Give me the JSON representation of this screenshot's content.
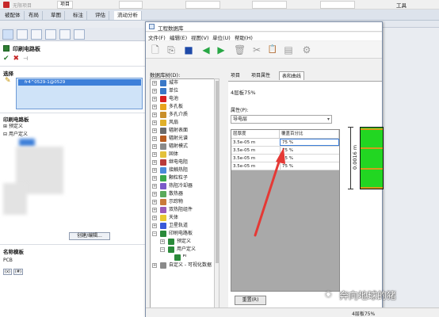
{
  "app": {
    "title": "无限项目",
    "project_label": "项目",
    "tools_label": "工具",
    "ribbon_tabs": [
      "被配体",
      "布局",
      "草图",
      "标注",
      "评估",
      "流动分析"
    ]
  },
  "left_panel": {
    "heading": "印刷电路板",
    "select_label": "选择",
    "selected_item": "fr4^0529-1@0529",
    "section_label": "印刷电路板",
    "tree": [
      "预定义",
      "用户定义"
    ],
    "create_button": "创建/编辑...",
    "name_section": "名称模板",
    "name_value": "PCB",
    "small_icons": [
      "(x)",
      "(#)"
    ]
  },
  "dialog": {
    "title": "工程数据库",
    "menu": [
      "文件(F)",
      "编辑(E)",
      "视图(V)",
      "单位(U)",
      "帮助(H)"
    ],
    "toolbar_icons": [
      "new-icon",
      "copy-icon",
      "save-icon",
      "back-icon",
      "forward-icon",
      "delete-icon",
      "cut-icon",
      "paste-icon",
      "document-icon",
      "settings-icon"
    ],
    "tree_label": "数据库树(D):",
    "tree": [
      {
        "label": "城市",
        "color": "#3a78c7"
      },
      {
        "label": "单位",
        "color": "#3a78c7"
      },
      {
        "label": "电池",
        "color": "#d92020"
      },
      {
        "label": "多孔板",
        "color": "#e8a31c"
      },
      {
        "label": "多孔介质",
        "color": "#c98f2a"
      },
      {
        "label": "风扇",
        "color": "#e0b02a"
      },
      {
        "label": "辐射表面",
        "color": "#6a6a6a"
      },
      {
        "label": "辐射光谱",
        "color": "#b85c20"
      },
      {
        "label": "辐射模式",
        "color": "#8a8a8a"
      },
      {
        "label": "固体",
        "color": "#e3c13a"
      },
      {
        "label": "继电电阻",
        "color": "#b83a3a"
      },
      {
        "label": "接触热阻",
        "color": "#4a8ad9"
      },
      {
        "label": "颗粒粒子",
        "color": "#3aa84a"
      },
      {
        "label": "热阻冷却器",
        "color": "#7a5ac9"
      },
      {
        "label": "散热器",
        "color": "#5aaa5a"
      },
      {
        "label": "示踪物",
        "color": "#c97a3a"
      },
      {
        "label": "双热阻组件",
        "color": "#9a5ab8"
      },
      {
        "label": "天体",
        "color": "#e8c830"
      },
      {
        "label": "卫星轨道",
        "color": "#3a5ad9"
      },
      {
        "label": "印刷电路板",
        "color": "#2a8a3a",
        "expanded": true
      },
      {
        "label": "预定义",
        "color": "#2a8a3a",
        "level": 1
      },
      {
        "label": "用户定义",
        "color": "#2a8a3a",
        "level": 1,
        "expanded": true
      },
      {
        "label": "",
        "color": "#2a8a3a",
        "level": 2
      },
      {
        "label": "自定义 - 可视化数据",
        "color": "#8a8a8a"
      }
    ],
    "tabs": [
      "项目",
      "项目属性",
      "表和曲线"
    ],
    "item_name": "4层板75%",
    "property_label": "属性(P):",
    "property_value": "导电层",
    "table_headers": [
      "层厚度",
      "覆盖百分比"
    ],
    "table_rows": [
      [
        "3.5e-05 m",
        "75 %"
      ],
      [
        "3.5e-05 m",
        "75 %"
      ],
      [
        "3.5e-05 m",
        "75 %"
      ],
      [
        "3.5e-05 m",
        "75 %"
      ]
    ],
    "reset_button": "重置(R)",
    "stack_label": "0.0016 m",
    "stack_colors": {
      "layer": "#22d622",
      "conductor": "#d59b1b"
    }
  },
  "status_bar": {
    "text": "4层板75%"
  },
  "watermark": "奔向地球的猪"
}
